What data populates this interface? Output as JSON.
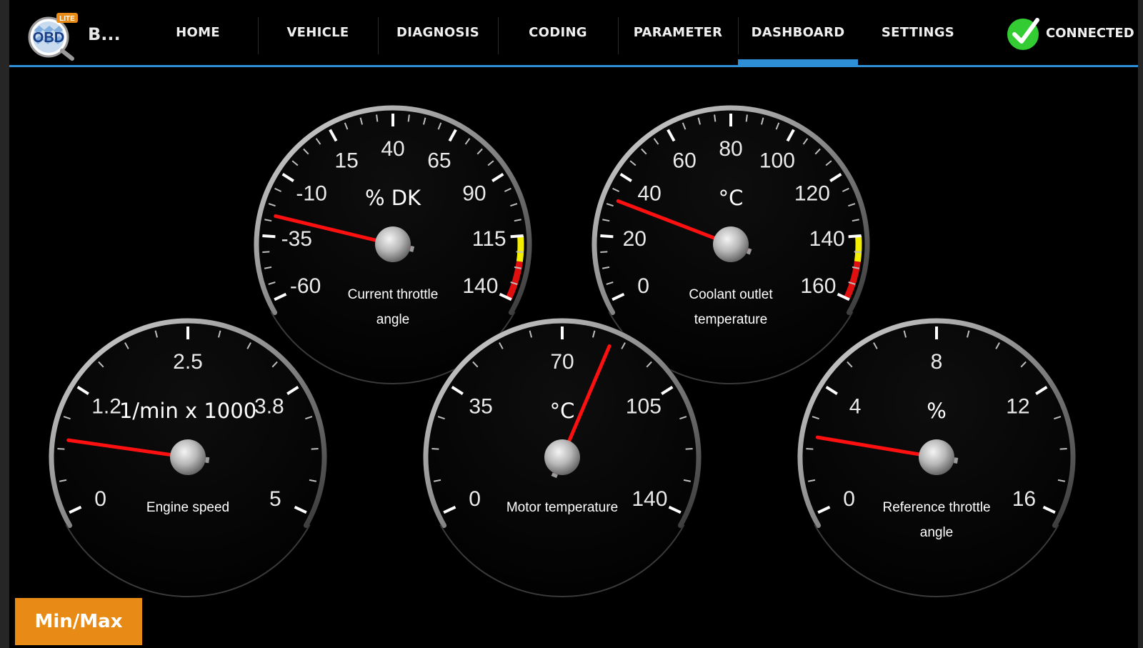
{
  "app": {
    "logo_text": "OBD",
    "logo_badge": "LITE",
    "title": "B..."
  },
  "tabs": [
    {
      "label": "HOME",
      "active": false
    },
    {
      "label": "VEHICLE",
      "active": false
    },
    {
      "label": "DIAGNOSIS",
      "active": false
    },
    {
      "label": "CODING",
      "active": false
    },
    {
      "label": "PARAMETER",
      "active": false
    },
    {
      "label": "DASHBOARD",
      "active": true
    },
    {
      "label": "SETTINGS",
      "active": false
    }
  ],
  "status": {
    "label": "CONNECTED",
    "icon": "check-circle-icon",
    "color": "#33cc33"
  },
  "colors": {
    "accent": "#2f8fd6",
    "needle": "#ff1010",
    "warning_yellow": "#f4ee00",
    "warning_red": "#e01010",
    "button": "#e88b16"
  },
  "gauges": [
    {
      "id": "throttle",
      "unit": "% DK",
      "label_lines": [
        "Current throttle",
        "angle"
      ],
      "ticks": [
        "-60",
        "-35",
        "-10",
        "15",
        "40",
        "65",
        "90",
        "115",
        "140"
      ],
      "value": -26.5,
      "min": -60,
      "max": 140,
      "warning_zones": [
        [
          115,
          125,
          "yellow"
        ],
        [
          125,
          140,
          "red"
        ]
      ]
    },
    {
      "id": "coolant",
      "unit": "°C",
      "label_lines": [
        "Coolant outlet",
        "temperature"
      ],
      "ticks": [
        "0",
        "20",
        "40",
        "60",
        "80",
        "100",
        "120",
        "140",
        "160"
      ],
      "value": 32,
      "min": 0,
      "max": 160,
      "warning_zones": [
        [
          140,
          148,
          "yellow"
        ],
        [
          148,
          160,
          "red"
        ]
      ]
    },
    {
      "id": "engine-speed",
      "unit": "1/min x 1000",
      "label_lines": [
        "Engine speed"
      ],
      "ticks": [
        "0",
        "1.2",
        "2.5",
        "3.8",
        "5"
      ],
      "value": 0.72,
      "min": 0,
      "max": 5,
      "warning_zones": []
    },
    {
      "id": "motor-temp",
      "unit": "°C",
      "label_lines": [
        "Motor temperature"
      ],
      "ticks": [
        "0",
        "35",
        "70",
        "105",
        "140"
      ],
      "value": 84,
      "min": 0,
      "max": 140,
      "warning_zones": []
    },
    {
      "id": "ref-throttle",
      "unit": "%",
      "label_lines": [
        "Reference throttle",
        "angle"
      ],
      "ticks": [
        "0",
        "4",
        "8",
        "12",
        "16"
      ],
      "value": 2.4,
      "min": 0,
      "max": 16,
      "warning_zones": []
    }
  ],
  "buttons": {
    "minmax": "Min/Max"
  }
}
